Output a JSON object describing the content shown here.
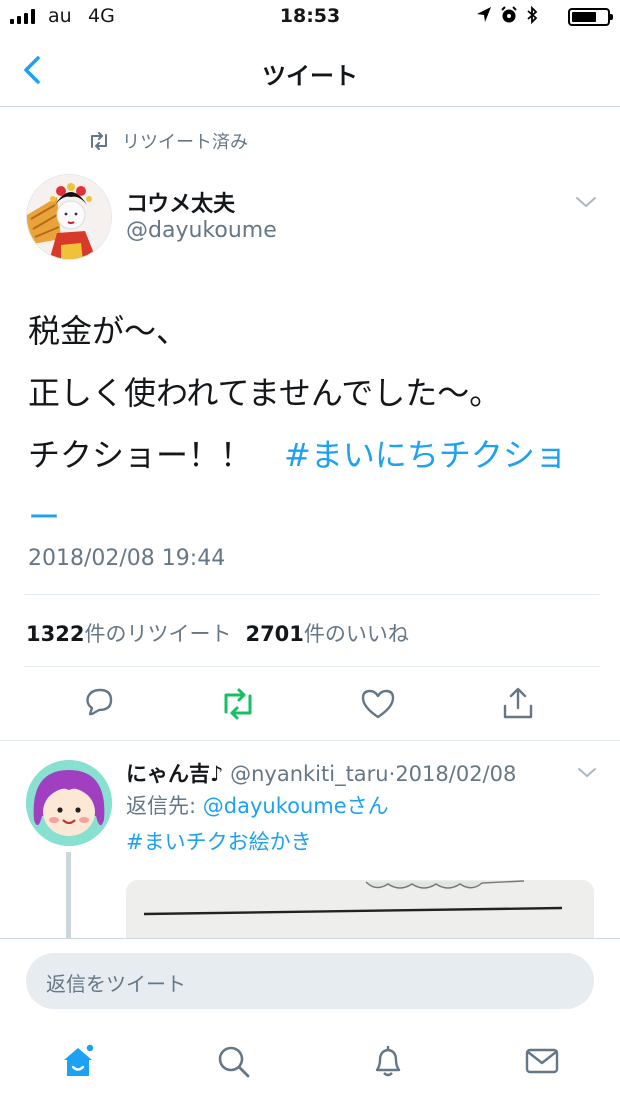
{
  "status_bar": {
    "carrier": "au",
    "network": "4G",
    "time": "18:53"
  },
  "nav": {
    "title": "ツイート"
  },
  "tweet": {
    "retweet_label": "リツイート済み",
    "author_name": "コウメ太夫",
    "author_handle": "@dayukoume",
    "text_lines": [
      "税金が〜、",
      "正しく使われてませんでした〜。",
      "チクショー！！　"
    ],
    "hashtag": "#まいにちチクショー",
    "timestamp": "2018/02/08 19:44",
    "retweet_count": "1322",
    "retweet_suffix": "件のリツイート",
    "like_count": "2701",
    "like_suffix": "件のいいね"
  },
  "reply": {
    "author_name": "にゃん吉♪",
    "author_handle": "@nyankiti_taru",
    "separator": "·",
    "date": "2018/02/08",
    "reply_to_prefix": "返信先: ",
    "reply_to_handle": "@dayukoume",
    "reply_to_suffix": "さん",
    "hashtag": "#まいチクお絵かき"
  },
  "composer": {
    "placeholder": "返信をツイート"
  },
  "colors": {
    "accent": "#1da1f2",
    "retweet_active": "#17bf63",
    "secondary_text": "#657786"
  },
  "icons": {
    "tabs": [
      "home-icon",
      "search-icon",
      "notifications-icon",
      "messages-icon"
    ],
    "actions": [
      "reply-icon",
      "retweet-icon",
      "like-icon",
      "share-icon"
    ]
  }
}
